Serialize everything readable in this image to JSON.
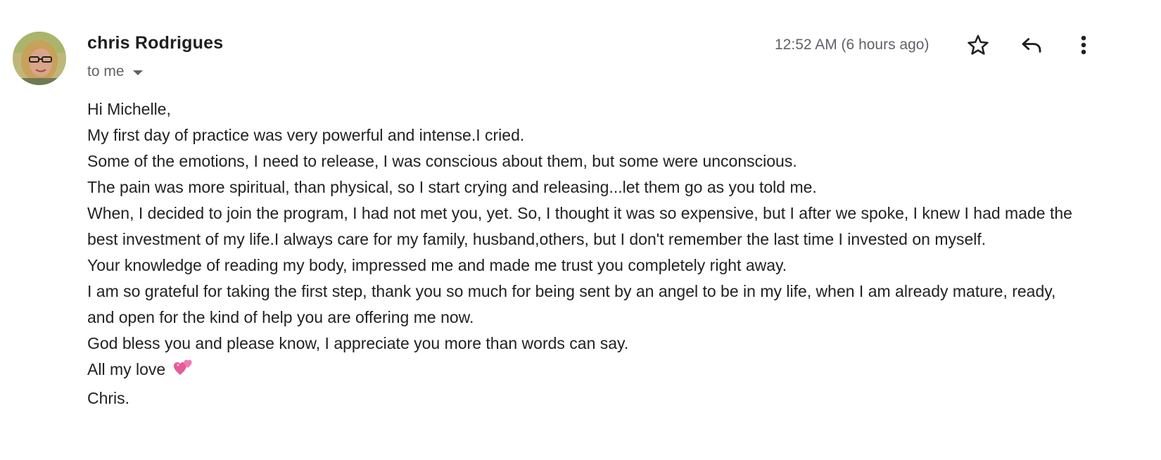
{
  "email": {
    "sender_name": "chris Rodrigues",
    "recipient_label": "to me",
    "timestamp": "12:52 AM (6 hours ago)",
    "avatar_icon": "user-avatar",
    "actions": {
      "star_icon": "star-icon",
      "reply_icon": "reply-icon",
      "more_icon": "more-vert-icon"
    },
    "body": {
      "greeting": "Hi Michelle,",
      "line1": "My first day of practice was very powerful and intense.I cried.",
      "line2": "Some of the emotions, I need to release, I was conscious about them, but some were unconscious.",
      "line3": "The pain was more spiritual, than physical, so I start crying and releasing...let them go as you told me.",
      "line4": "When, I decided to join the program, I had not met you, yet. So, I thought it was so expensive, but I after we spoke, I knew I had made the best investment of my life.I always care for my family, husband,others, but I don't remember the last time I invested on myself.",
      "line5": "Your knowledge of reading my body, impressed me and made me trust you completely right away.",
      "line6": "I am so grateful for taking the first step, thank you so much for being sent by an angel to be in my life, when I am already mature, ready, and open for the kind of help you are offering me now.",
      "line7": "God bless you and please know, I appreciate you more than words can say.",
      "closing": "All my love",
      "closing_emoji_icon": "two-hearts-icon",
      "signature": "Chris."
    }
  },
  "colors": {
    "text_primary": "#202124",
    "text_secondary": "#5f6368",
    "heart_pink": "#e8609a"
  }
}
